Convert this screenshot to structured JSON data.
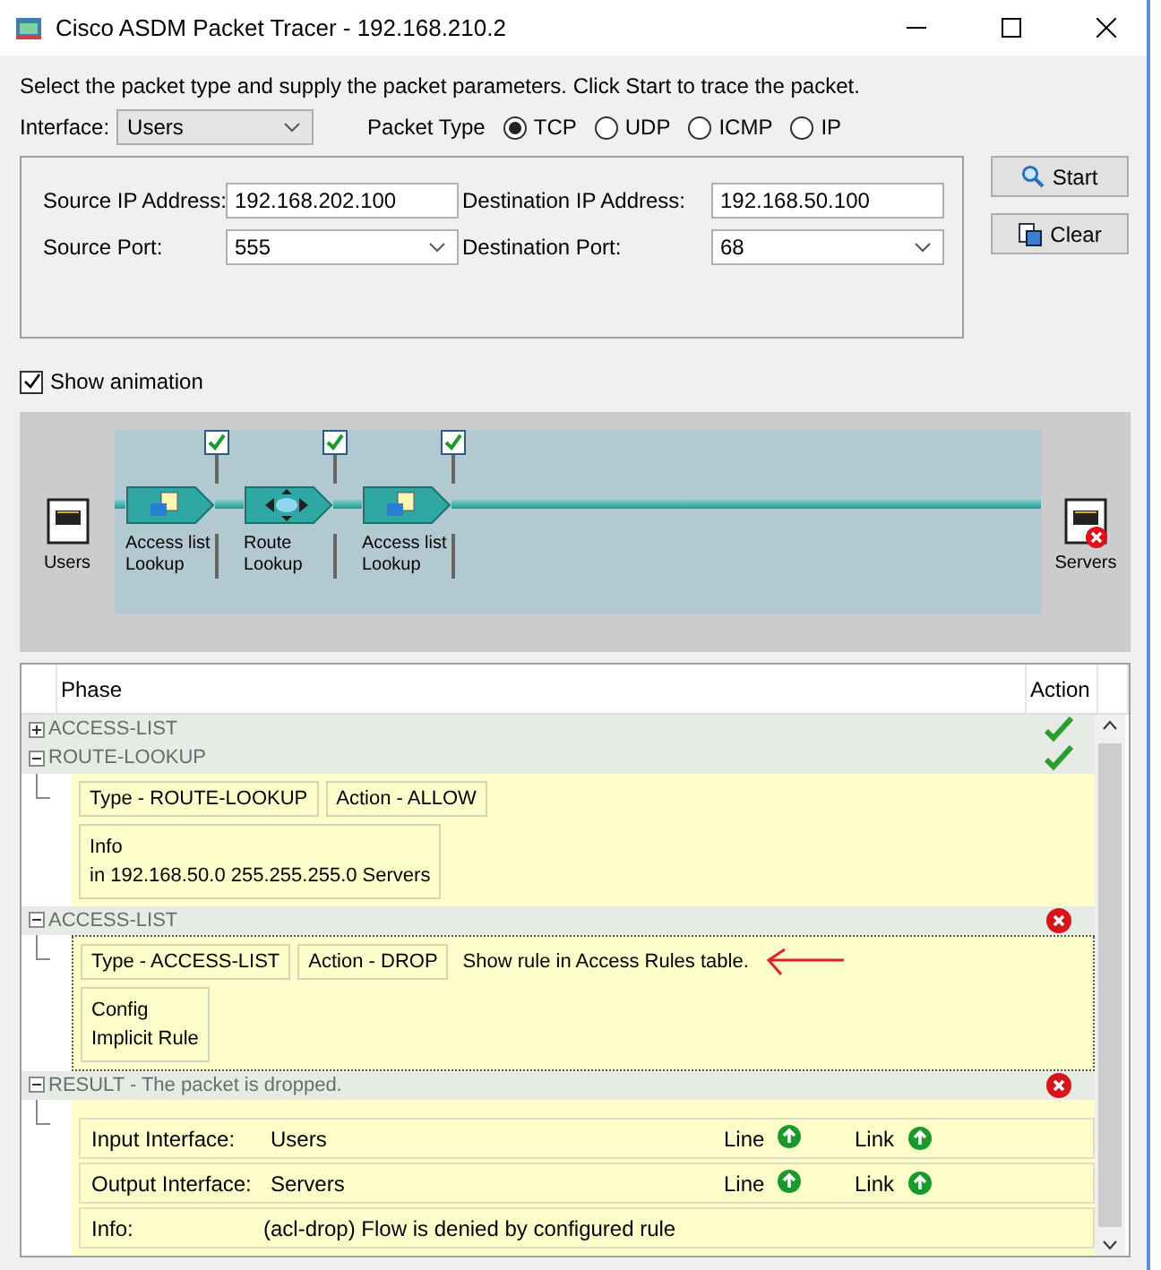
{
  "window": {
    "title": "Cisco ASDM Packet Tracer - 192.168.210.2"
  },
  "instructions": "Select the packet type and supply the packet parameters. Click Start to trace the packet.",
  "interface": {
    "label": "Interface:",
    "value": "Users"
  },
  "packet_type": {
    "label": "Packet Type",
    "options": [
      {
        "label": "TCP",
        "selected": true
      },
      {
        "label": "UDP",
        "selected": false
      },
      {
        "label": "ICMP",
        "selected": false
      },
      {
        "label": "IP",
        "selected": false
      }
    ]
  },
  "params": [
    {
      "label": "Source IP Address:",
      "value": "192.168.202.100",
      "kind": "text"
    },
    {
      "label": "Destination IP Address:",
      "value": "192.168.50.100",
      "kind": "text"
    },
    {
      "label": "Source Port:",
      "value": "555",
      "kind": "dropdown"
    },
    {
      "label": "Destination Port:",
      "value": "68",
      "kind": "dropdown"
    }
  ],
  "buttons": [
    {
      "label": "Start",
      "kind": "start"
    },
    {
      "label": "Clear",
      "kind": "clear"
    }
  ],
  "show_animation": {
    "label": "Show animation",
    "checked": true
  },
  "animation": {
    "source": "Users",
    "destination": "Servers",
    "destination_dropped": true,
    "phases": [
      {
        "kind": "acl",
        "label_lines": [
          "Access list",
          "Lookup"
        ],
        "checked": true
      },
      {
        "kind": "route",
        "label_lines": [
          "Route",
          "Lookup"
        ],
        "checked": true
      },
      {
        "kind": "acl",
        "label_lines": [
          "Access list",
          "Lookup"
        ],
        "checked": true
      }
    ]
  },
  "table": {
    "columns": [
      "Phase",
      "Action"
    ],
    "rows": [
      {
        "title": "ACCESS-LIST",
        "expanded": false,
        "allowed": true
      },
      {
        "title": "ROUTE-LOOKUP",
        "expanded": true,
        "allowed": true,
        "kind": "phase",
        "tags": [
          "Type - ROUTE-LOOKUP",
          "Action - ALLOW"
        ],
        "box": [
          "Info",
          "in 192.168.50.0 255.255.255.0 Servers"
        ]
      },
      {
        "title": "ACCESS-LIST",
        "expanded": true,
        "allowed": false,
        "kind": "phase",
        "tags": [
          "Type - ACCESS-LIST",
          "Action - DROP"
        ],
        "link": "Show rule in Access Rules table.",
        "annotated": true,
        "box": [
          "Config",
          "Implicit Rule"
        ]
      },
      {
        "title": "RESULT - The packet is dropped.",
        "expanded": true,
        "allowed": false,
        "kind": "result",
        "interfaces": [
          {
            "label": "Input Interface:",
            "value": "Users",
            "line": "Line",
            "line_up": true,
            "link": "Link",
            "link_up": true
          },
          {
            "label": "Output Interface:",
            "value": "Servers",
            "line": "Line",
            "line_up": true,
            "link": "Link",
            "link_up": true
          }
        ],
        "info": {
          "label": "Info:",
          "value": "(acl-drop) Flow is denied by configured rule"
        }
      }
    ]
  }
}
